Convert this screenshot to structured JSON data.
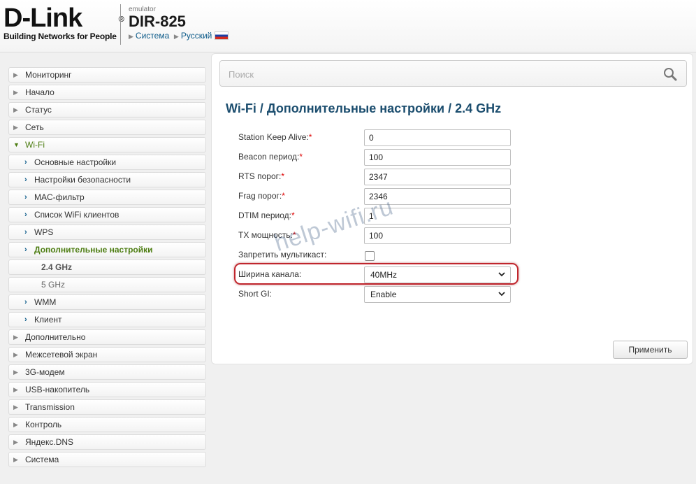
{
  "header": {
    "logo_text": "D-Link",
    "logo_reg": "®",
    "logo_tagline": "Building Networks for People",
    "emulator_label": "emulator",
    "model": "DIR-825",
    "link_system": "Система",
    "link_language": "Русский"
  },
  "sidebar": {
    "items": [
      {
        "label": "Мониторинг"
      },
      {
        "label": "Начало"
      },
      {
        "label": "Статус"
      },
      {
        "label": "Сеть"
      },
      {
        "label": "Wi-Fi"
      },
      {
        "label": "Основные настройки"
      },
      {
        "label": "Настройки безопасности"
      },
      {
        "label": "MAC-фильтр"
      },
      {
        "label": "Список WiFi клиентов"
      },
      {
        "label": "WPS"
      },
      {
        "label": "Дополнительные настройки"
      },
      {
        "label": "2.4 GHz"
      },
      {
        "label": "5 GHz"
      },
      {
        "label": "WMM"
      },
      {
        "label": "Клиент"
      },
      {
        "label": "Дополнительно"
      },
      {
        "label": "Межсетевой экран"
      },
      {
        "label": "3G-модем"
      },
      {
        "label": "USB-накопитель"
      },
      {
        "label": "Transmission"
      },
      {
        "label": "Контроль"
      },
      {
        "label": "Яндекс.DNS"
      },
      {
        "label": "Система"
      }
    ]
  },
  "search": {
    "placeholder": "Поиск"
  },
  "main": {
    "title": "Wi-Fi /  Дополнительные настройки /  2.4 GHz",
    "fields": {
      "station_keep_alive": {
        "label": "Station Keep Alive:",
        "required": "*",
        "value": "0"
      },
      "beacon": {
        "label": "Beacon период:",
        "required": "*",
        "value": "100"
      },
      "rts": {
        "label": "RTS порог:",
        "required": "*",
        "value": "2347"
      },
      "frag": {
        "label": "Frag порог:",
        "required": "*",
        "value": "2346"
      },
      "dtim": {
        "label": "DTIM период:",
        "required": "*",
        "value": "1"
      },
      "tx": {
        "label": "TX мощность:",
        "required": "*",
        "value": "100"
      },
      "multicast": {
        "label": "Запретить мультикаст:",
        "checked": false
      },
      "channel_width": {
        "label": "Ширина канала:",
        "value": "40MHz"
      },
      "short_gi": {
        "label": "Short GI:",
        "value": "Enable"
      }
    },
    "apply_label": "Применить",
    "watermark": "help-wifi.ru"
  },
  "colors": {
    "accent_green": "#4d7d12",
    "title_blue": "#1b4d6e",
    "highlight_red": "#c0262d",
    "required_red": "#dd0000"
  }
}
